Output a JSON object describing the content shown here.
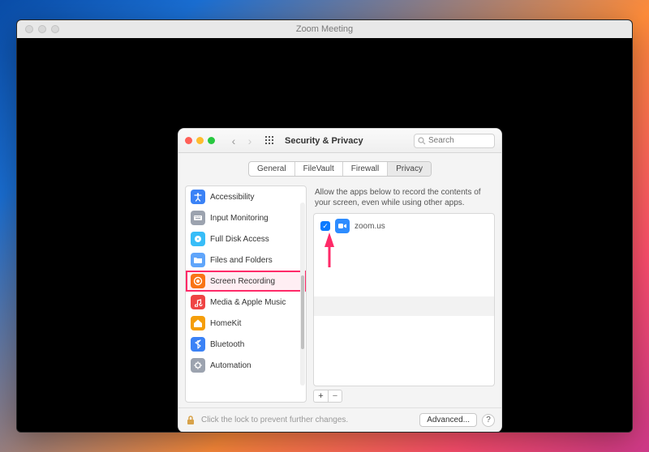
{
  "outer": {
    "title": "Zoom Meeting"
  },
  "pref": {
    "title": "Security & Privacy",
    "search_placeholder": "Search",
    "tabs": {
      "general": "General",
      "filevault": "FileVault",
      "firewall": "Firewall",
      "privacy": "Privacy"
    },
    "description": "Allow the apps below to record the contents of your screen, even while using other apps.",
    "advanced_label": "Advanced...",
    "help_label": "?",
    "lock_text": "Click the lock to prevent further changes.",
    "plus": "+",
    "minus": "−"
  },
  "sidebar": {
    "items": [
      {
        "label": "Accessibility",
        "icon": "accessibility",
        "color": "#3b82f6"
      },
      {
        "label": "Input Monitoring",
        "icon": "input",
        "color": "#9ca3af"
      },
      {
        "label": "Full Disk Access",
        "icon": "disk",
        "color": "#38bdf8"
      },
      {
        "label": "Files and Folders",
        "icon": "folder",
        "color": "#60a5fa"
      },
      {
        "label": "Screen Recording",
        "icon": "record",
        "color": "#f97316",
        "selected": true
      },
      {
        "label": "Media & Apple Music",
        "icon": "music",
        "color": "#ef4444"
      },
      {
        "label": "HomeKit",
        "icon": "home",
        "color": "#f59e0b"
      },
      {
        "label": "Bluetooth",
        "icon": "bluetooth",
        "color": "#3b82f6"
      },
      {
        "label": "Automation",
        "icon": "automation",
        "color": "#9ca3af"
      }
    ]
  },
  "apps": [
    {
      "name": "zoom.us",
      "checked": true
    }
  ]
}
